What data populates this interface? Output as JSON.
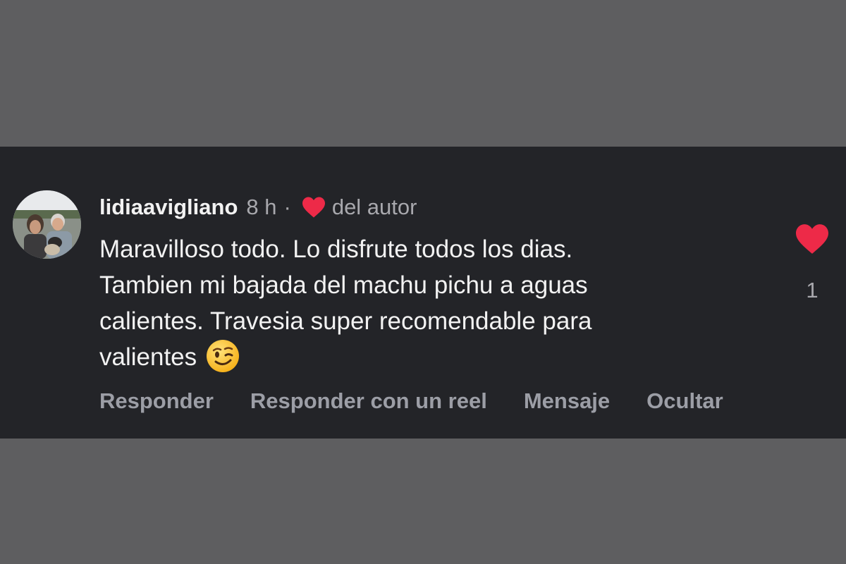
{
  "comment": {
    "username": "lidiaavigliano",
    "time": "8 h",
    "separator": "·",
    "liked_by_author_label": "del autor",
    "text_lines": [
      "Maravilloso todo. Lo disfrute todos los dias.",
      "Tambien mi bajada del machu pichu a aguas",
      "calientes. Travesia super recomendable para",
      "valientes"
    ],
    "emoji": "wink-face",
    "like_count": "1"
  },
  "actions": {
    "reply": "Responder",
    "reply_reel": "Responder con un reel",
    "message": "Mensaje",
    "hide": "Ocultar"
  },
  "colors": {
    "panel_bg": "#232428",
    "outer_bg": "#5e5e60",
    "heart": "#ed2a48",
    "text_primary": "#f2f2f2",
    "text_secondary": "#a8a8ad",
    "action_text": "#9c9ea6"
  }
}
